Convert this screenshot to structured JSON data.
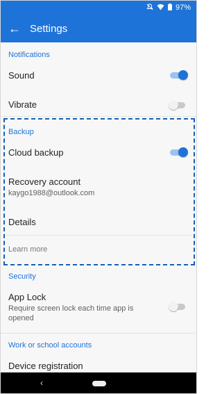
{
  "statusbar": {
    "mute_icon": "bell-off-icon",
    "wifi_icon": "wifi-icon",
    "battery_icon": "battery-icon",
    "battery_label": "97%"
  },
  "appbar": {
    "back_icon": "arrow-left-icon",
    "back_glyph": "←",
    "title": "Settings",
    "color": "#1e73d8"
  },
  "notifications": {
    "header": "Notifications",
    "sound": {
      "label": "Sound",
      "enabled": true
    },
    "vibrate": {
      "label": "Vibrate",
      "enabled": false
    }
  },
  "backup": {
    "header": "Backup",
    "cloud_backup": {
      "label": "Cloud backup",
      "enabled": true
    },
    "recovery": {
      "label": "Recovery account",
      "value": "kaygo1988@outlook.com"
    },
    "details_label": "Details",
    "learn_more": "Learn more"
  },
  "security": {
    "header": "Security",
    "app_lock": {
      "label": "App Lock",
      "description": "Require screen lock each time app is opened",
      "enabled": false
    }
  },
  "work": {
    "header": "Work or school accounts",
    "device_registration": "Device registration"
  },
  "navbar": {
    "back_glyph": "‹"
  }
}
